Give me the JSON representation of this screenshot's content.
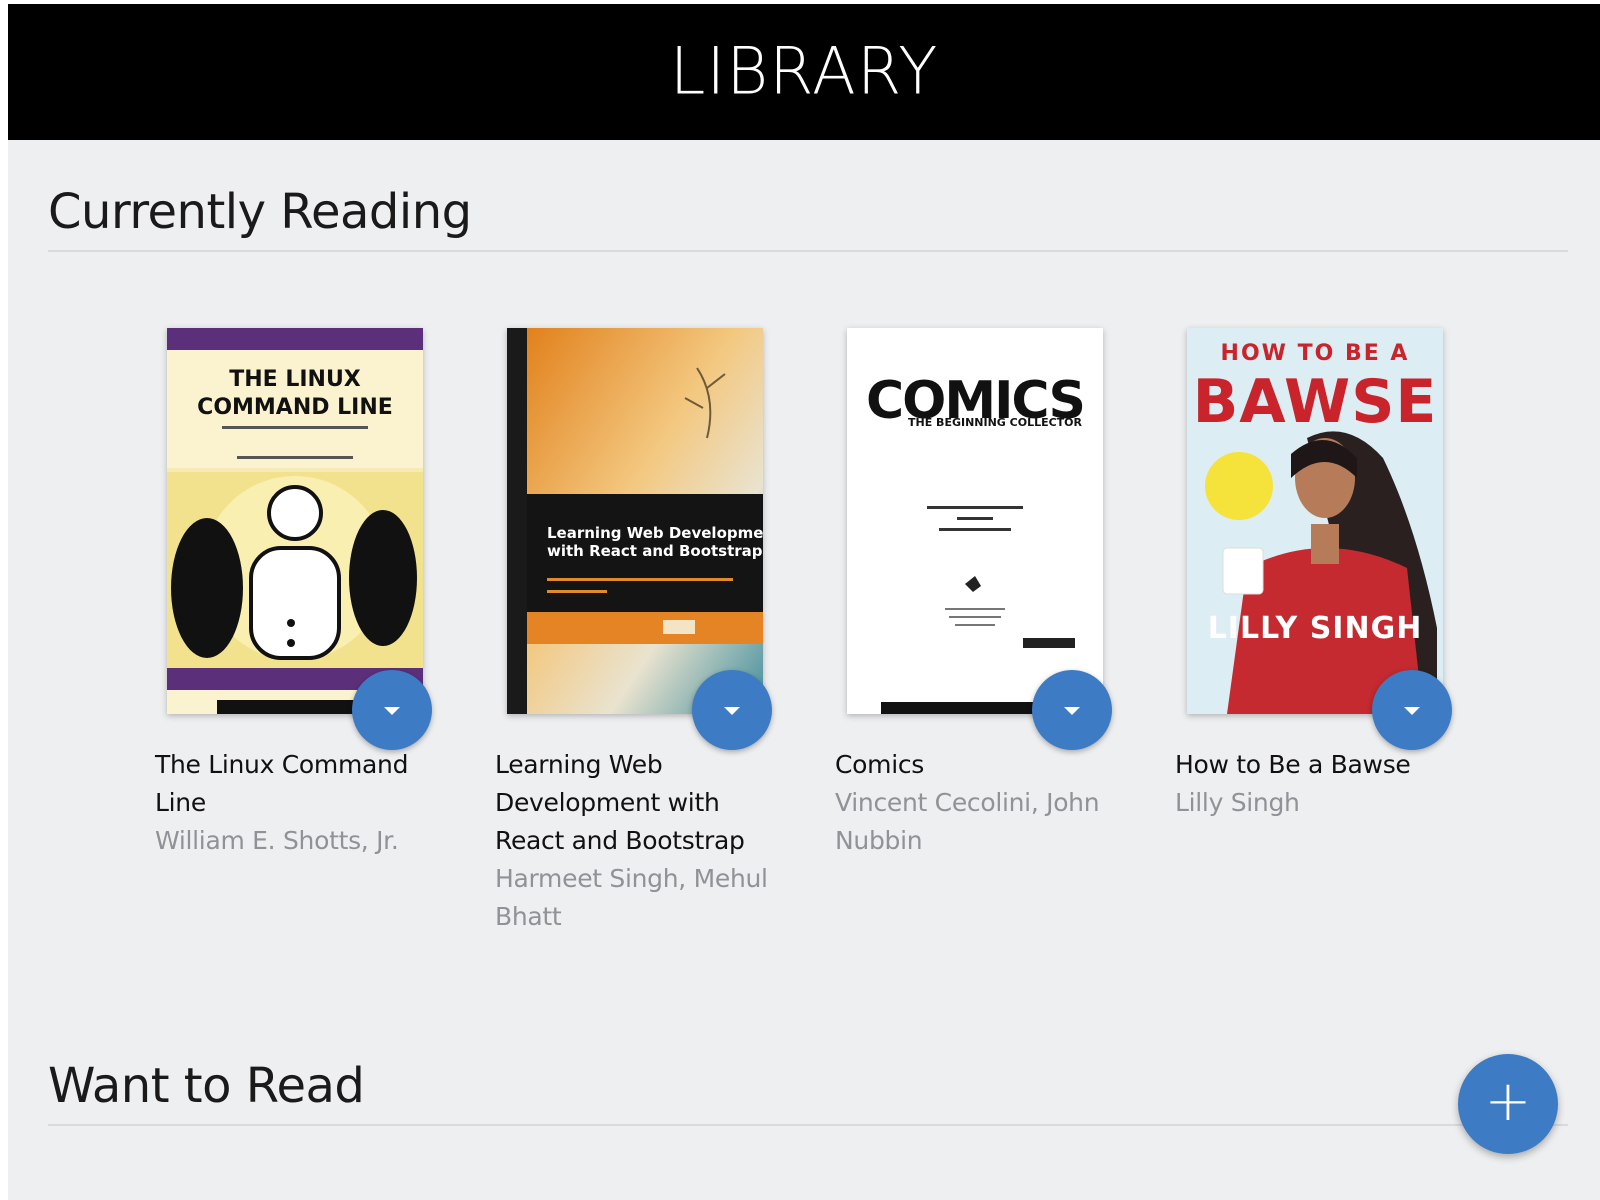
{
  "header": {
    "title": "LIBRARY"
  },
  "shelves": {
    "current": {
      "title": "Currently Reading"
    },
    "want": {
      "title": "Want to Read"
    }
  },
  "books": [
    {
      "title": "The Linux Command Line",
      "authors": "William E. Shotts, Jr.",
      "cover_text": [
        "THE LINUX",
        "COMMAND LINE"
      ]
    },
    {
      "title": "Learning Web Development with React and Bootstrap",
      "authors": "Harmeet Singh, Mehul Bhatt",
      "cover_text": [
        "Learning Web Development",
        "with React and Bootstrap"
      ]
    },
    {
      "title": "Comics",
      "authors": "Vincent Cecolini, John Nubbin",
      "cover_text": [
        "COMICS",
        "THE BEGINNING COLLECTOR"
      ]
    },
    {
      "title": "How to Be a Bawse",
      "authors": "Lilly Singh",
      "cover_text": [
        "HOW TO BE A",
        "BAWSE",
        "LILLY SINGH"
      ]
    }
  ],
  "icons": {
    "shelf_changer": "caret-down-icon",
    "add": "plus-icon"
  },
  "add_button_label": "+",
  "colors": {
    "accent": "#3d7bc4",
    "header_bg": "#000000",
    "page_bg": "#eeeff1",
    "author": "#8f9296"
  }
}
